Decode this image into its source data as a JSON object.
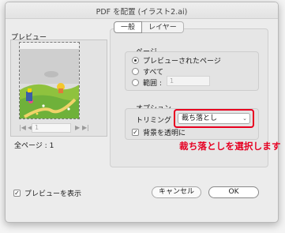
{
  "window": {
    "title": "PDF を配置 (イラスト2.ai)"
  },
  "preview": {
    "label": "プレビュー",
    "page_field_value": "1",
    "total_pages_label": "全ページ : 1",
    "nav_first_icon": "first-page-icon",
    "nav_prev_icon": "prev-page-icon",
    "nav_next_icon": "next-page-icon",
    "nav_last_icon": "last-page-icon"
  },
  "tabs": [
    {
      "label": "一般",
      "selected": true
    },
    {
      "label": "レイヤー",
      "selected": false
    }
  ],
  "pages": {
    "label": "ページ",
    "options": [
      {
        "label": "プレビューされたページ",
        "selected": true
      },
      {
        "label": "すべて",
        "selected": false
      },
      {
        "label": "範囲 :",
        "selected": false
      }
    ],
    "range_value": "1"
  },
  "options": {
    "label": "オプション",
    "trim_label": "トリミング",
    "trim_value": "裁ち落とし",
    "transparent_bg_label": "背景を透明に",
    "transparent_bg_checked": true
  },
  "annotation": {
    "text": "裁ち落としを選択します",
    "color": "#e60022"
  },
  "footer": {
    "show_preview_label": "プレビューを表示",
    "show_preview_checked": true,
    "cancel_label": "キャンセル",
    "ok_label": "OK"
  },
  "colors": {
    "highlight": "#e8001f",
    "dialog_bg": "#ececec"
  }
}
